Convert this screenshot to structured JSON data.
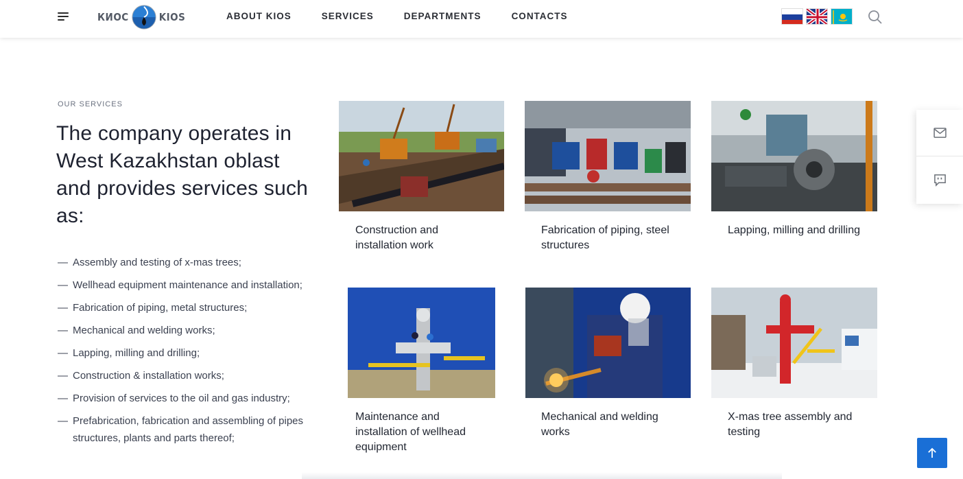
{
  "header": {
    "logo_left": "КИОС",
    "logo_right": "KIOS",
    "nav": [
      "ABOUT KIOS",
      "SERVICES",
      "DEPARTMENTS",
      "CONTACTS"
    ],
    "languages": [
      "ru-flag",
      "uk-flag",
      "kz-flag"
    ]
  },
  "intro": {
    "eyebrow": "OUR SERVICES",
    "headline": "The company operates in West Kazakhstan oblast and provides services such as:"
  },
  "services_list": [
    "Assembly and testing of x-mas trees;",
    "Wellhead equipment maintenance and installation;",
    "Fabrication of piping, metal structures;",
    "Mechanical and welding works;",
    "Lapping, milling and drilling;",
    "Construction & installation works;",
    "Provision of services to the oil and gas industry;",
    "Prefabrication, fabrication and assembling of pipes structures, plants and parts thereof;"
  ],
  "list_dash": "—",
  "cards": [
    {
      "title": "Construction and installation work"
    },
    {
      "title": "Fabrication of piping, steel structures"
    },
    {
      "title": "Lapping, milling and drilling"
    },
    {
      "title": "Maintenance and installation of wellhead equipment"
    },
    {
      "title": "Mechanical and welding works"
    },
    {
      "title": "X-mas tree assembly and testing"
    }
  ],
  "colors": {
    "accent": "#1a6fd6",
    "text": "#1e2230"
  }
}
